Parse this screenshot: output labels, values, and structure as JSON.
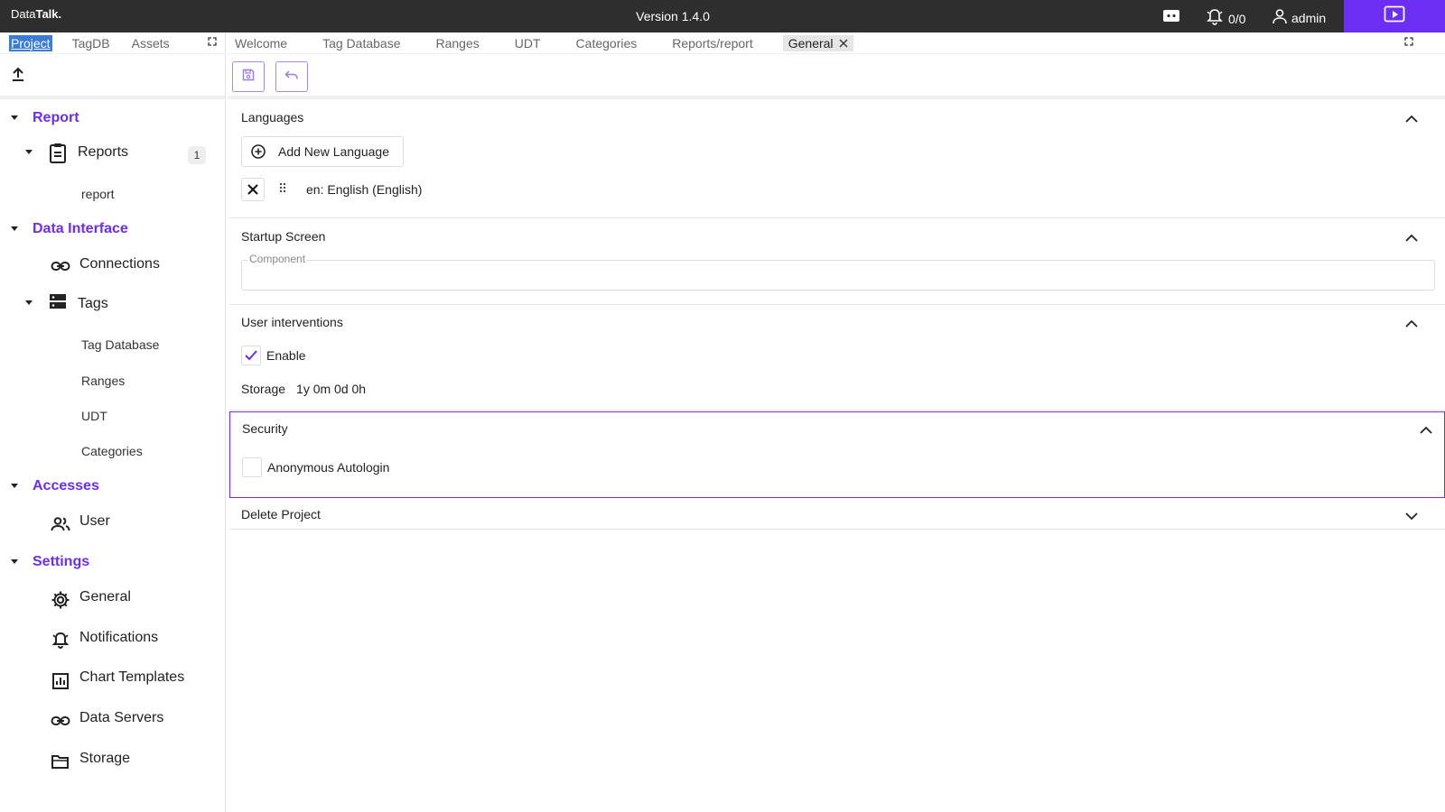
{
  "topbar": {
    "brand_prefix": "Data",
    "brand_bold": "Talk.",
    "version": "Version 1.4.0",
    "alarms": "0/0",
    "user": "admin"
  },
  "left": {
    "tabs": [
      "Project",
      "TagDB",
      "Assets"
    ],
    "tree": {
      "report_section": "Report",
      "reports": "Reports",
      "reports_count": "1",
      "report_leaf": "report",
      "data_interface_section": "Data Interface",
      "connections": "Connections",
      "tags": "Tags",
      "tag_leaves": [
        "Tag Database",
        "Ranges",
        "UDT",
        "Categories"
      ],
      "accesses_section": "Accesses",
      "user": "User",
      "settings_section": "Settings",
      "settings_items": [
        "General",
        "Notifications",
        "Chart Templates",
        "Data Servers",
        "Storage"
      ]
    }
  },
  "right": {
    "tabs": [
      "Welcome",
      "Tag Database",
      "Ranges",
      "UDT",
      "Categories",
      "Reports/report"
    ],
    "active_tab": "General",
    "languages": {
      "title": "Languages",
      "add_button": "Add New Language",
      "items": [
        "en: English (English)"
      ]
    },
    "startup": {
      "title": "Startup Screen",
      "component_label": "Component",
      "component_value": ""
    },
    "interventions": {
      "title": "User interventions",
      "enable_label": "Enable",
      "enable_checked": true,
      "storage_label": "Storage",
      "storage_value": "1y 0m 0d 0h"
    },
    "security": {
      "title": "Security",
      "anon_label": "Anonymous Autologin",
      "anon_checked": false
    },
    "delete": {
      "title": "Delete Project"
    }
  },
  "colors": {
    "accent": "#6c2ef2",
    "topbar": "#2e2e2e"
  }
}
